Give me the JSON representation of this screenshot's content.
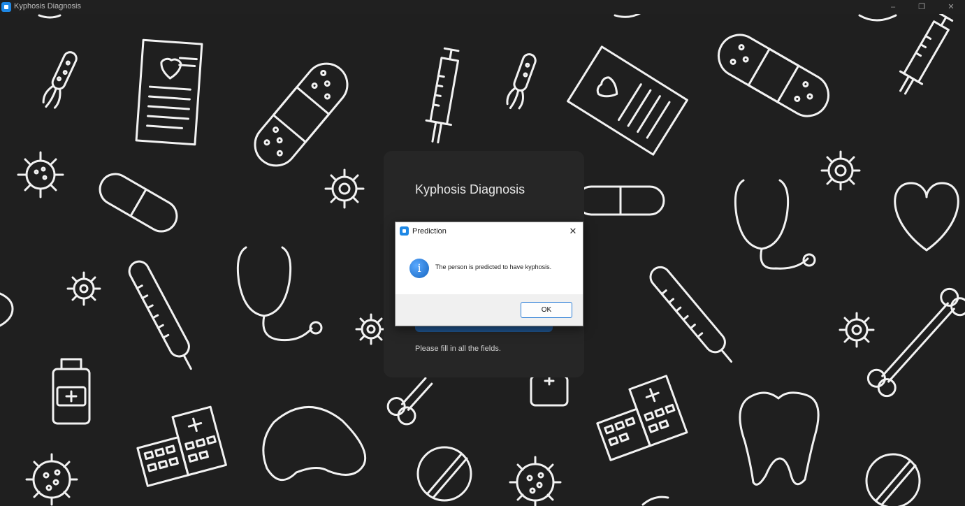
{
  "window": {
    "title": "Kyphosis Diagnosis",
    "controls": {
      "minimize": "–",
      "restore": "❐",
      "close": "✕"
    }
  },
  "panel": {
    "title": "Kyphosis Diagnosis",
    "message": "Please fill in all the fields."
  },
  "dialog": {
    "title": "Prediction",
    "close": "✕",
    "icon_glyph": "i",
    "message": "The person is predicted to have kyphosis.",
    "ok_label": "OK"
  },
  "colors": {
    "background": "#1f1f1f",
    "panel": "#262626",
    "accent": "#1e88e5",
    "button": "#1f538d"
  }
}
